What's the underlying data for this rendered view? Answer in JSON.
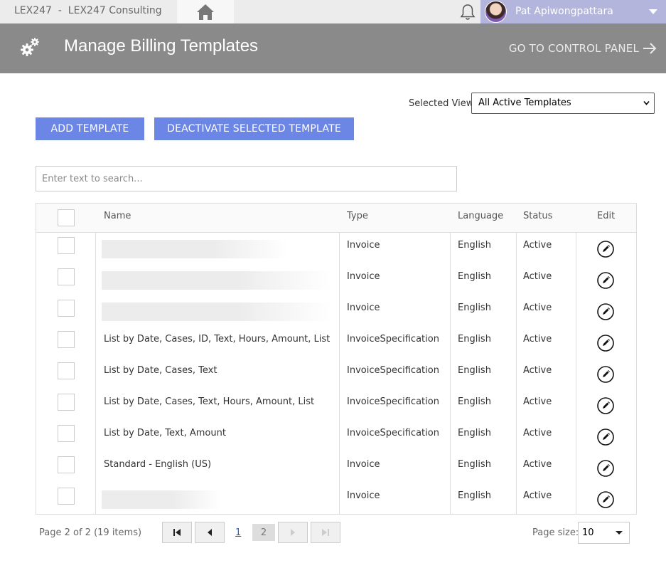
{
  "topbar": {
    "tenant": "LEX247  -  LEX247 Consulting",
    "user_name": "Pat Apiwongpattara"
  },
  "header": {
    "title": "Manage Billing Templates",
    "control_panel": "GO TO CONTROL PANEL"
  },
  "view": {
    "label": "Selected View:",
    "selected": "All Active Templates"
  },
  "buttons": {
    "add": "ADD TEMPLATE",
    "deactivate": "DEACTIVATE SELECTED TEMPLATE"
  },
  "search": {
    "placeholder": "Enter text to search..."
  },
  "table": {
    "columns": [
      "Name",
      "Type",
      "Language",
      "Status",
      "Edit"
    ],
    "rows": [
      {
        "name": "",
        "type": "Invoice",
        "language": "English",
        "status": "Active"
      },
      {
        "name": "",
        "type": "Invoice",
        "language": "English",
        "status": "Active"
      },
      {
        "name": "",
        "type": "Invoice",
        "language": "English",
        "status": "Active"
      },
      {
        "name": "List by Date, Cases, ID, Text, Hours, Amount, List",
        "type": "InvoiceSpecification",
        "language": "English",
        "status": "Active"
      },
      {
        "name": "List by Date, Cases, Text",
        "type": "InvoiceSpecification",
        "language": "English",
        "status": "Active"
      },
      {
        "name": "List by Date, Cases, Text, Hours, Amount, List",
        "type": "InvoiceSpecification",
        "language": "English",
        "status": "Active"
      },
      {
        "name": "List by Date, Text, Amount",
        "type": "InvoiceSpecification",
        "language": "English",
        "status": "Active"
      },
      {
        "name": "Standard - English (US)",
        "type": "Invoice",
        "language": "English",
        "status": "Active"
      },
      {
        "name": "",
        "type": "Invoice",
        "language": "English",
        "status": "Active"
      }
    ]
  },
  "pager": {
    "info": "Page 2 of 2 (19 items)",
    "pages": [
      "1",
      "2"
    ],
    "page_size_label": "Page size:",
    "page_size": "10"
  },
  "colors": {
    "accent": "#6b86e4",
    "header_bg": "#8a8a8a",
    "user_bg": "#b3b5dc"
  }
}
